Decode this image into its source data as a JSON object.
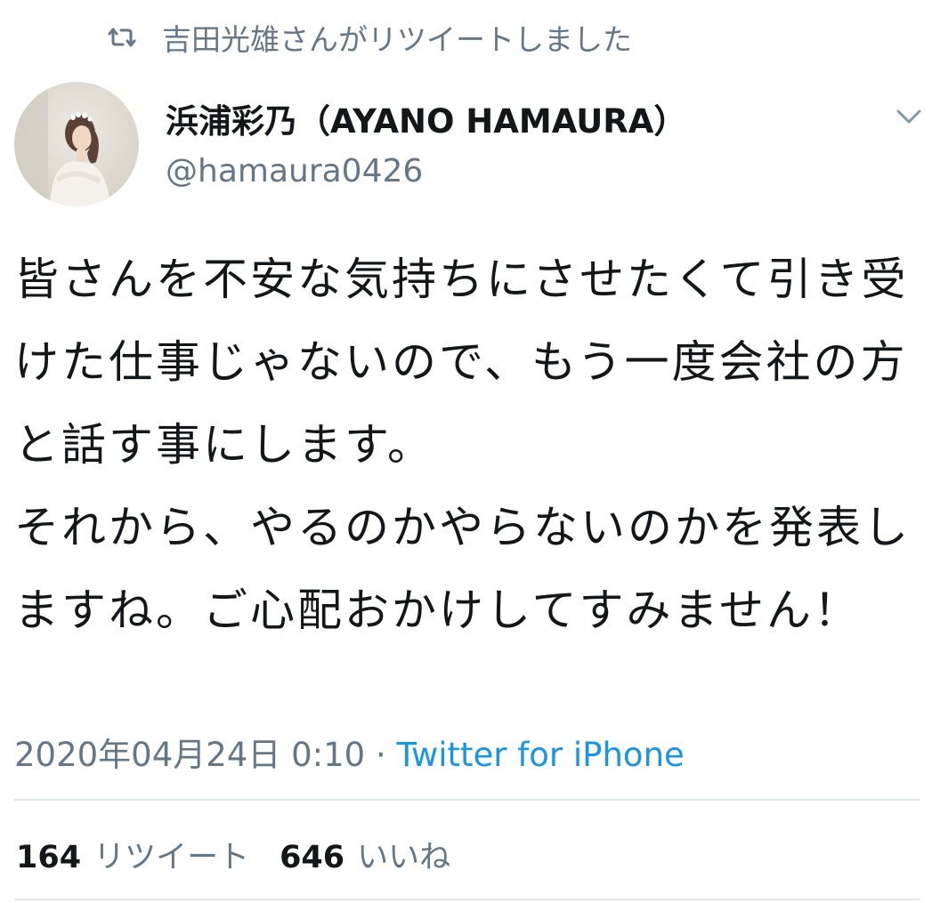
{
  "retweet_context": {
    "icon": "retweet-icon",
    "text": "吉田光雄さんがリツイートしました"
  },
  "author": {
    "display_name": "浜浦彩乃（AYANO HAMAURA）",
    "handle": "@hamaura0426"
  },
  "tweet": {
    "text": "皆さんを不安な気持ちにさせたくて引き受けた仕事じゃないので、もう一度会社の方と話す事にします。\nそれから、やるのかやらないのかを発表しますね。ご心配おかけしてすみません！",
    "timestamp": "2020年04月24日 0:10",
    "separator": " · ",
    "source": "Twitter for iPhone"
  },
  "stats": {
    "retweets_count": "164",
    "retweets_label": "リツイート",
    "likes_count": "646",
    "likes_label": "いいね"
  },
  "colors": {
    "text_primary": "#14171a",
    "text_secondary": "#657786",
    "link": "#1b95e0",
    "divider": "#e1e8ed"
  }
}
